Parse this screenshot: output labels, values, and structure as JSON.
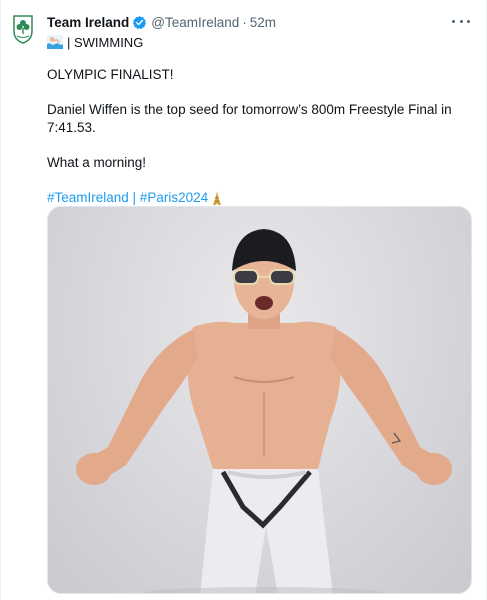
{
  "tweet": {
    "author_name": "Team Ireland",
    "author_handle": "@TeamIreland",
    "separator": "·",
    "time_ago": "52m",
    "subline_text": "| SWIMMING",
    "paragraphs": [
      "OLYMPIC FINALIST!",
      "Daniel Wiffen is the top seed for tomorrow’s 800m Freestyle Final in 7:41.53.",
      "What a morning!"
    ],
    "hashtags": "#TeamIreland | #Paris2024"
  },
  "icons": {
    "avatar": "team-ireland-crest-icon",
    "verified": "verified-badge-icon",
    "more": "more-options-icon",
    "swimmer": "swimmer-emoji-icon",
    "tower": "eiffel-tower-emoji-icon"
  },
  "colors": {
    "link": "#1d9bf0",
    "verified": "#1d9bf0",
    "secondary_text": "#536471",
    "crest_green": "#2e8b57"
  }
}
